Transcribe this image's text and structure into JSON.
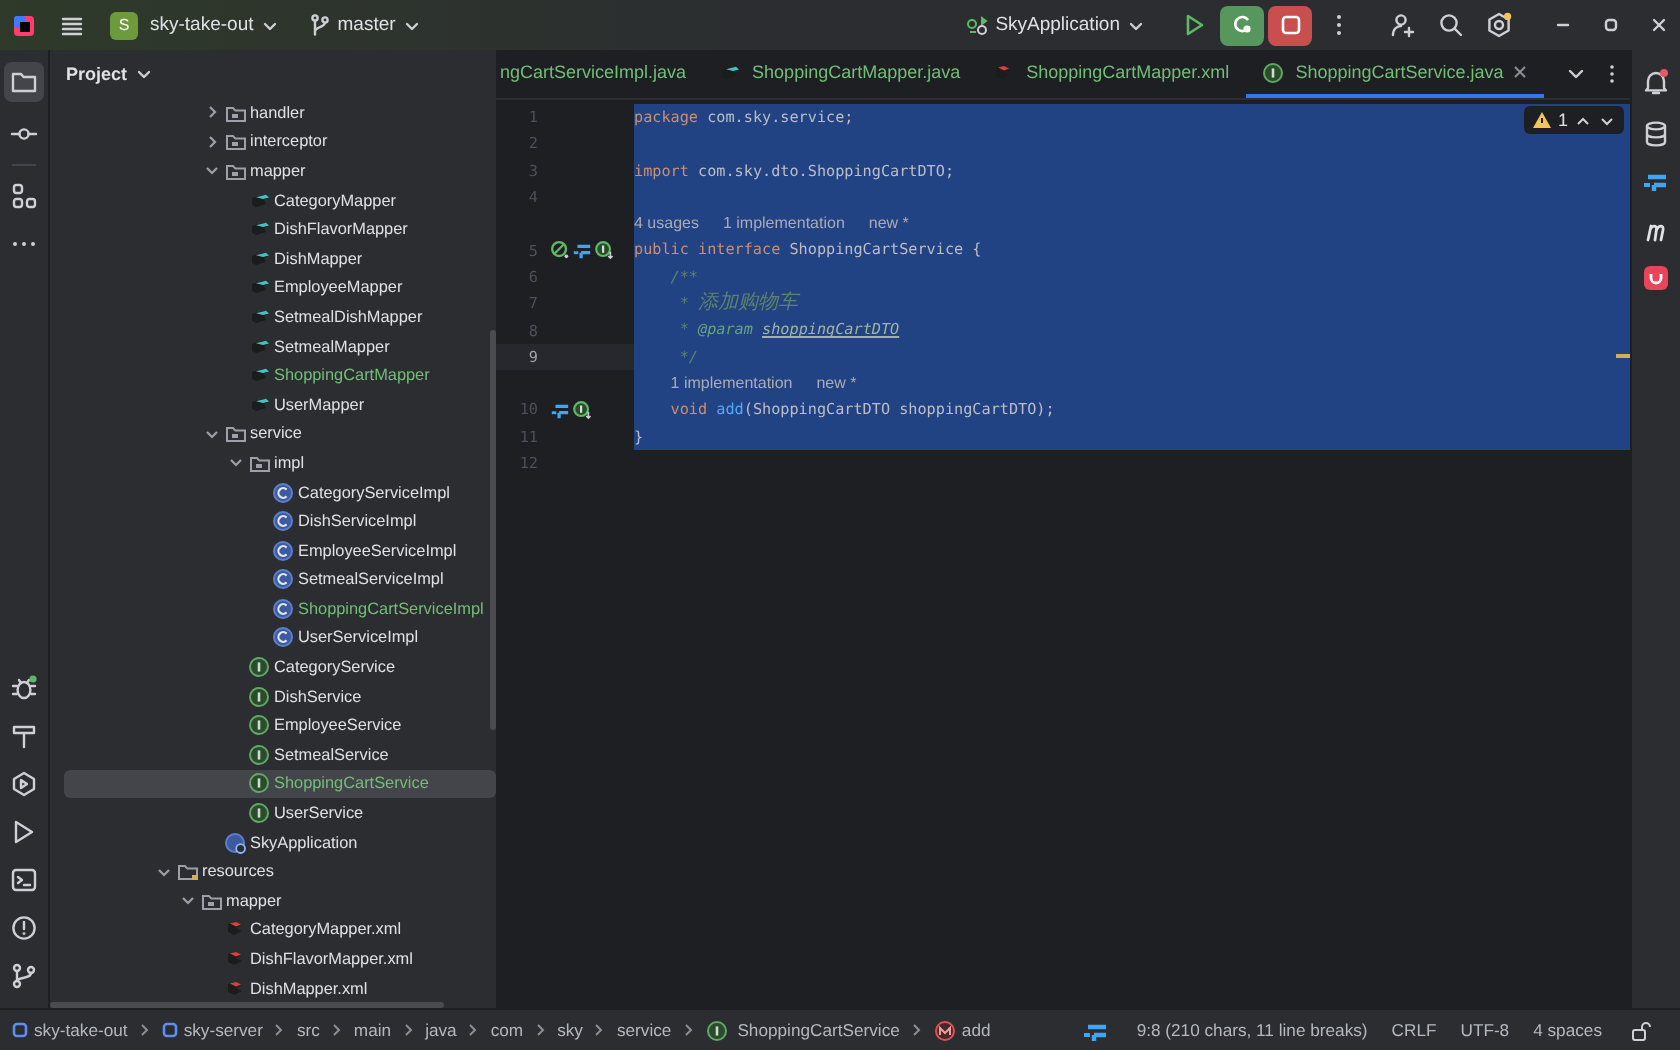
{
  "title_bar": {
    "project": {
      "badge": "S",
      "name": "sky-take-out"
    },
    "branch": "master",
    "run_config": "SkyApplication"
  },
  "left_tools": [
    {
      "kind": "project",
      "selected": true
    },
    {
      "kind": "commit",
      "selected": false
    },
    {
      "kind": "structure",
      "selected": false
    },
    {
      "kind": "more",
      "selected": false
    }
  ],
  "left_tools_bottom": [
    {
      "kind": "debug"
    },
    {
      "kind": "build"
    },
    {
      "kind": "services"
    },
    {
      "kind": "run"
    },
    {
      "kind": "terminal"
    },
    {
      "kind": "problems"
    },
    {
      "kind": "git"
    }
  ],
  "project_panel": {
    "title": "Project",
    "tree": [
      {
        "label": "handler",
        "kind": "folder",
        "expanded": false,
        "selected": false,
        "added": false
      },
      {
        "label": "interceptor",
        "kind": "folder",
        "expanded": false,
        "selected": false,
        "added": false
      },
      {
        "label": "mapper",
        "kind": "folder",
        "expanded": true,
        "selected": false,
        "added": false,
        "children": [
          {
            "label": "CategoryMapper",
            "kind": "mapper",
            "selected": false,
            "added": false
          },
          {
            "label": "DishFlavorMapper",
            "kind": "mapper",
            "selected": false,
            "added": false
          },
          {
            "label": "DishMapper",
            "kind": "mapper",
            "selected": false,
            "added": false
          },
          {
            "label": "EmployeeMapper",
            "kind": "mapper",
            "selected": false,
            "added": false
          },
          {
            "label": "SetmealDishMapper",
            "kind": "mapper",
            "selected": false,
            "added": false
          },
          {
            "label": "SetmealMapper",
            "kind": "mapper",
            "selected": false,
            "added": false
          },
          {
            "label": "ShoppingCartMapper",
            "kind": "mapper",
            "selected": false,
            "added": true
          },
          {
            "label": "UserMapper",
            "kind": "mapper",
            "selected": false,
            "added": false
          }
        ]
      },
      {
        "label": "service",
        "kind": "folder",
        "expanded": true,
        "selected": false,
        "added": false,
        "children": [
          {
            "label": "impl",
            "kind": "folder",
            "expanded": true,
            "selected": false,
            "added": false,
            "children": [
              {
                "label": "CategoryServiceImpl",
                "kind": "class",
                "selected": false,
                "added": false
              },
              {
                "label": "DishServiceImpl",
                "kind": "class",
                "selected": false,
                "added": false
              },
              {
                "label": "EmployeeServiceImpl",
                "kind": "class",
                "selected": false,
                "added": false
              },
              {
                "label": "SetmealServiceImpl",
                "kind": "class",
                "selected": false,
                "added": false
              },
              {
                "label": "ShoppingCartServiceImpl",
                "kind": "class",
                "selected": false,
                "added": true
              },
              {
                "label": "UserServiceImpl",
                "kind": "class",
                "selected": false,
                "added": false
              }
            ]
          },
          {
            "label": "CategoryService",
            "kind": "interface",
            "selected": false,
            "added": false
          },
          {
            "label": "DishService",
            "kind": "interface",
            "selected": false,
            "added": false
          },
          {
            "label": "EmployeeService",
            "kind": "interface",
            "selected": false,
            "added": false
          },
          {
            "label": "SetmealService",
            "kind": "interface",
            "selected": false,
            "added": false
          },
          {
            "label": "ShoppingCartService",
            "kind": "interface",
            "selected": true,
            "added": true
          },
          {
            "label": "UserService",
            "kind": "interface",
            "selected": false,
            "added": false
          }
        ]
      },
      {
        "label": "SkyApplication",
        "kind": "application",
        "selected": false,
        "added": false
      }
    ],
    "resources_tree": [
      {
        "label": "resources",
        "kind": "resources",
        "expanded": true,
        "selected": false,
        "added": false,
        "children": [
          {
            "label": "mapper",
            "kind": "folder",
            "expanded": true,
            "selected": false,
            "added": false,
            "children": [
              {
                "label": "CategoryMapper.xml",
                "kind": "xml",
                "selected": false,
                "added": false
              },
              {
                "label": "DishFlavorMapper.xml",
                "kind": "xml",
                "selected": false,
                "added": false
              },
              {
                "label": "DishMapper.xml",
                "kind": "xml",
                "selected": false,
                "added": false
              }
            ]
          }
        ]
      }
    ]
  },
  "editor_tabs": [
    {
      "label": "ngCartServiceImpl.java",
      "selected": false,
      "added": true
    },
    {
      "label": "ShoppingCartMapper.java",
      "kind": "mapper",
      "selected": false,
      "added": true
    },
    {
      "label": "ShoppingCartMapper.xml",
      "kind": "xml",
      "selected": false,
      "added": true
    },
    {
      "label": "ShoppingCartService.java",
      "kind": "interface",
      "selected": true,
      "added": true
    }
  ],
  "inspection": {
    "warnings": "1"
  },
  "code_lines": [
    {
      "kind": "code",
      "number": "1",
      "selected": true,
      "current": false,
      "tokens": [
        {
          "text": "package",
          "kind": "keyword"
        },
        {
          "text": " com.sky.service;",
          "kind": "plain"
        }
      ]
    },
    {
      "kind": "code",
      "number": "2",
      "selected": true,
      "current": false
    },
    {
      "kind": "code",
      "number": "3",
      "selected": true,
      "current": false,
      "tokens": [
        {
          "text": "import",
          "kind": "keyword"
        },
        {
          "text": " com.sky.dto.ShoppingCartDTO;",
          "kind": "plain"
        }
      ]
    },
    {
      "kind": "code",
      "number": "4",
      "selected": true,
      "current": false
    },
    {
      "kind": "hint",
      "selected": true,
      "items": [
        "4 usages",
        "1 implementation",
        "new *"
      ]
    },
    {
      "kind": "code",
      "number": "5",
      "selected": true,
      "current": false,
      "gutter_icons": [
        {
          "kind": "spring"
        },
        {
          "kind": "jump"
        },
        {
          "kind": "implemented"
        }
      ],
      "tokens": [
        {
          "text": "public interface",
          "kind": "keyword"
        },
        {
          "text": " ShoppingCartService {",
          "kind": "plain"
        }
      ]
    },
    {
      "kind": "code",
      "number": "6",
      "selected": true,
      "current": false,
      "tokens": [
        {
          "text": "    /**",
          "kind": "doc"
        }
      ]
    },
    {
      "kind": "code",
      "number": "7",
      "selected": true,
      "current": false,
      "tokens": [
        {
          "text": "     * ",
          "kind": "doc"
        },
        {
          "text": "添加购物车",
          "kind": "doccjk"
        }
      ]
    },
    {
      "kind": "code",
      "number": "8",
      "selected": true,
      "current": false,
      "tokens": [
        {
          "text": "     * ",
          "kind": "doc"
        },
        {
          "text": "@param ",
          "kind": "doctag"
        },
        {
          "text": "shoppingCartDTO",
          "kind": "docparam"
        }
      ]
    },
    {
      "kind": "code",
      "number": "9",
      "selected": true,
      "current": true,
      "tokens": [
        {
          "text": "     */",
          "kind": "doc"
        }
      ]
    },
    {
      "kind": "hint",
      "selected": true,
      "items": [
        "1 implementation",
        "new *"
      ]
    },
    {
      "kind": "code",
      "number": "10",
      "selected": true,
      "current": false,
      "gutter_icons": [
        {
          "kind": "jump"
        },
        {
          "kind": "implemented"
        }
      ],
      "tokens": [
        {
          "text": "    void",
          "kind": "keyword"
        },
        {
          "text": " add",
          "kind": "method"
        },
        {
          "text": "(ShoppingCartDTO shoppingCartDTO);",
          "kind": "plain"
        }
      ]
    },
    {
      "kind": "code",
      "number": "11",
      "selected": true,
      "current": false,
      "tokens": [
        {
          "text": "}",
          "kind": "plain"
        }
      ]
    },
    {
      "kind": "code",
      "number": "12",
      "selected": false,
      "current": false
    }
  ],
  "right_tools": [
    {
      "kind": "notifications"
    },
    {
      "kind": "database"
    },
    {
      "kind": "jump"
    },
    {
      "kind": "maven"
    },
    {
      "kind": "app"
    }
  ],
  "breadcrumbs": [
    {
      "label": "sky-take-out",
      "kind": "module"
    },
    {
      "label": "sky-server",
      "kind": "module"
    },
    {
      "label": "src",
      "kind": "plain"
    },
    {
      "label": "main",
      "kind": "plain"
    },
    {
      "label": "java",
      "kind": "plain"
    },
    {
      "label": "com",
      "kind": "plain"
    },
    {
      "label": "sky",
      "kind": "plain"
    },
    {
      "label": "service",
      "kind": "plain"
    },
    {
      "label": "ShoppingCartService",
      "kind": "interface"
    },
    {
      "label": "add",
      "kind": "method"
    }
  ],
  "status_bar": {
    "position": "9:8 (210 chars, 11 line breaks)",
    "line_separator": "CRLF",
    "encoding": "UTF-8",
    "indent": "4 spaces"
  }
}
